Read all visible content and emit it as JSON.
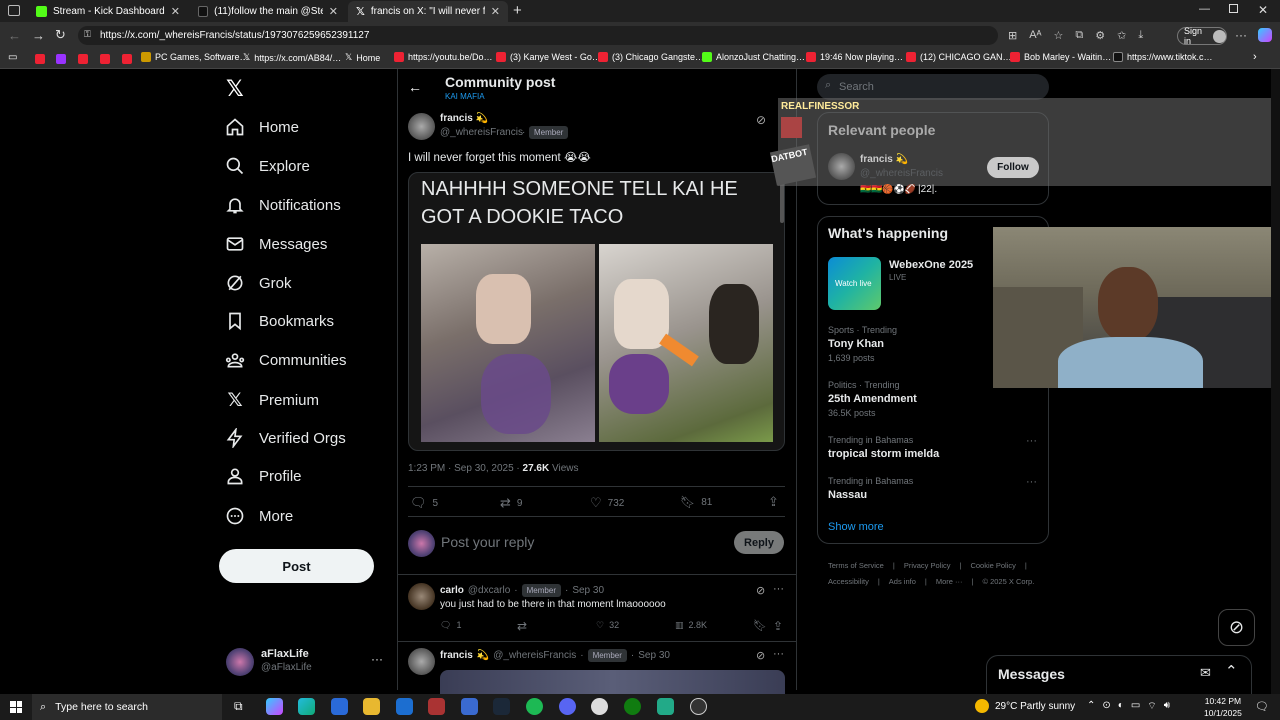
{
  "tabs": [
    {
      "title": "Stream - Kick Dashboard",
      "fav": "#53fc18"
    },
    {
      "title": "(11)follow the main @Steph Spe…",
      "fav": "#111"
    },
    {
      "title": "francis  on X: \"I will never fo…",
      "fav": "#111"
    }
  ],
  "address": {
    "url": "https://x.com/_whereisFrancis/status/1973076259652391127",
    "signin": "Sign in"
  },
  "bookmarks": [
    "PC Games, Software…",
    "https://x.com/AB84/…",
    "Home",
    "https://youtu.be/Do…",
    "(3) Kanye West - Go…",
    "(3) Chicago Gangste…",
    "AlonzoJust Chatting…",
    "19:46 Now playing…",
    "(12) CHICAGO GAN…",
    "Bob Marley - Waitin…",
    "https://www.tiktok.c…"
  ],
  "nav": {
    "items": [
      "Home",
      "Explore",
      "Notifications",
      "Messages",
      "Grok",
      "Bookmarks",
      "Communities",
      "Premium",
      "Verified Orgs",
      "Profile",
      "More"
    ],
    "post_label": "Post",
    "account_name": "aFlaxLife",
    "account_handle": "@aFlaxLife"
  },
  "header": {
    "title": "Community post",
    "community": "KAI MAFIA"
  },
  "post": {
    "author": "francis",
    "handle": "@_whereisFrancis",
    "badge": "Member",
    "text": "I will never forget this moment 😭😭",
    "meme_caption": "NAHHHH SOMEONE TELL KAI HE GOT A DOOKIE TACO",
    "time": "1:23 PM · Sep 30, 2025 · ",
    "views_count": "27.6K",
    "views_label": " Views",
    "replies": "5",
    "reposts": "9",
    "likes": "732",
    "bookmarks": "81"
  },
  "reply_box": {
    "placeholder": "Post your reply",
    "button": "Reply"
  },
  "replies": [
    {
      "name": "carlo",
      "handle": "@dxcarlo",
      "badge": "Member",
      "date": "Sep 30",
      "text": "you just had to be there in that moment lmaoooooo",
      "replies": "1",
      "likes": "32",
      "views": "2.8K"
    },
    {
      "name": "francis",
      "handle": "@_whereisFrancis",
      "badge": "Member",
      "date": "Sep 30"
    }
  ],
  "right": {
    "search_placeholder": "Search",
    "overlay_name": "REALFINESSOR",
    "relevant_title": "Relevant people",
    "relevant_name": "francis",
    "relevant_handle": "@_whereisFrancis",
    "follow": "Follow",
    "relevant_bio": "|22|.",
    "happening_title": "What's happening",
    "event_title": "WebexOne 2025",
    "event_live": "LIVE",
    "event_thumb": "Watch live",
    "trends": [
      {
        "meta": "Sports · Trending",
        "name": "Tony Khan",
        "posts": "1,639 posts"
      },
      {
        "meta": "Politics · Trending",
        "name": "25th Amendment",
        "posts": "36.5K posts"
      },
      {
        "meta": "Trending in Bahamas",
        "name": "tropical storm imelda",
        "posts": ""
      },
      {
        "meta": "Trending in Bahamas",
        "name": "Nassau",
        "posts": ""
      }
    ],
    "show_more": "Show more",
    "footer": [
      "Terms of Service",
      "Privacy Policy",
      "Cookie Policy",
      "Accessibility",
      "Ads info",
      "More ···",
      "© 2025 X Corp."
    ],
    "messages": "Messages"
  },
  "taskbar": {
    "search": "Type here to search",
    "weather": "29°C  Partly sunny",
    "time": "10:42 PM",
    "date": "10/1/2025"
  }
}
